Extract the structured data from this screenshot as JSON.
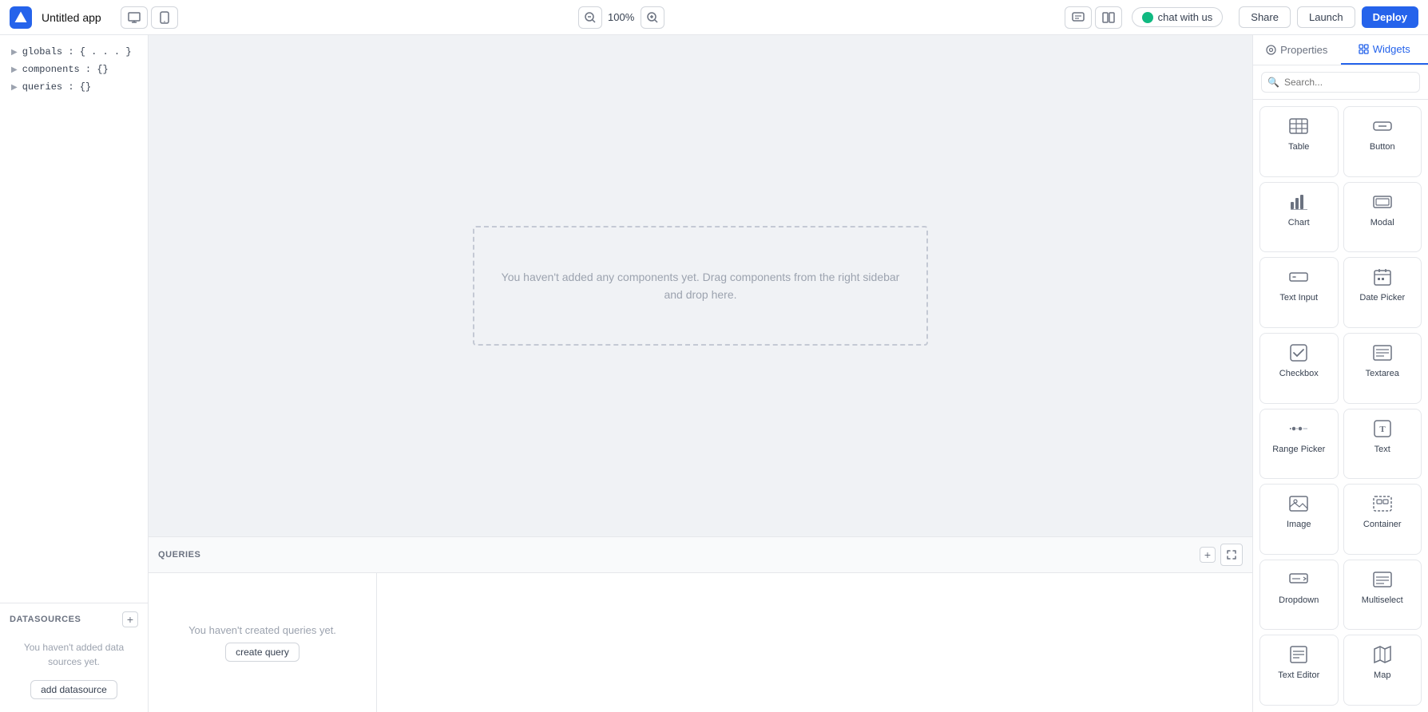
{
  "topnav": {
    "app_title": "Untitled app",
    "zoom_value": "100%",
    "chat_label": "chat with us",
    "share_label": "Share",
    "launch_label": "Launch",
    "deploy_label": "Deploy"
  },
  "left_sidebar": {
    "tree_items": [
      {
        "key": "globals",
        "value": "{ . . . }"
      },
      {
        "key": "components",
        "value": "{}"
      },
      {
        "key": "queries",
        "value": "{}"
      }
    ],
    "datasources": {
      "title": "DATASOURCES",
      "empty_text": "You haven't added data sources yet.",
      "add_btn_label": "add datasource"
    }
  },
  "canvas": {
    "drop_zone_text_line1": "You haven't added any components yet. Drag components from the right sidebar",
    "drop_zone_text_line2": "and drop here."
  },
  "queries_panel": {
    "title": "QUERIES",
    "empty_text": "You haven't created queries yet.",
    "create_btn_label": "create query"
  },
  "right_sidebar": {
    "tabs": [
      {
        "id": "properties",
        "label": "Properties",
        "icon": "settings-icon"
      },
      {
        "id": "widgets",
        "label": "Widgets",
        "icon": "widgets-icon",
        "active": true
      }
    ],
    "search_placeholder": "Search...",
    "widgets": [
      {
        "id": "table",
        "label": "Table",
        "icon": "table-icon"
      },
      {
        "id": "button",
        "label": "Button",
        "icon": "button-icon"
      },
      {
        "id": "chart",
        "label": "Chart",
        "icon": "chart-icon"
      },
      {
        "id": "modal",
        "label": "Modal",
        "icon": "modal-icon"
      },
      {
        "id": "text-input",
        "label": "Text Input",
        "icon": "text-input-icon"
      },
      {
        "id": "date-picker",
        "label": "Date Picker",
        "icon": "date-picker-icon"
      },
      {
        "id": "checkbox",
        "label": "Checkbox",
        "icon": "checkbox-icon"
      },
      {
        "id": "textarea",
        "label": "Textarea",
        "icon": "textarea-icon"
      },
      {
        "id": "range-picker",
        "label": "Range Picker",
        "icon": "range-picker-icon"
      },
      {
        "id": "text",
        "label": "Text",
        "icon": "text-icon"
      },
      {
        "id": "image",
        "label": "Image",
        "icon": "image-icon"
      },
      {
        "id": "container",
        "label": "Container",
        "icon": "container-icon"
      },
      {
        "id": "dropdown",
        "label": "Dropdown",
        "icon": "dropdown-icon"
      },
      {
        "id": "multiselect",
        "label": "Multiselect",
        "icon": "multiselect-icon"
      },
      {
        "id": "text-editor",
        "label": "Text Editor",
        "icon": "text-editor-icon"
      },
      {
        "id": "map",
        "label": "Map",
        "icon": "map-icon"
      }
    ]
  },
  "colors": {
    "accent": "#2563eb",
    "border": "#e5e7eb",
    "text_muted": "#9ca3af",
    "text_body": "#374151"
  }
}
